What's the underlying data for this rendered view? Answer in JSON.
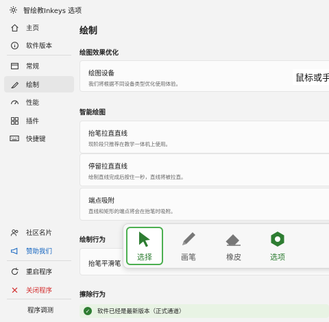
{
  "window": {
    "title": "智绘教Inkeys 选项",
    "icon": "gear-icon"
  },
  "sidebar": {
    "items": [
      {
        "label": "主页",
        "icon": "home-icon"
      },
      {
        "label": "软件版本",
        "icon": "info-icon"
      },
      {
        "label": "常规",
        "icon": "window-icon"
      },
      {
        "label": "绘制",
        "icon": "pen-icon",
        "active": true
      },
      {
        "label": "性能",
        "icon": "gauge-icon"
      },
      {
        "label": "插件",
        "icon": "puzzle-icon"
      },
      {
        "label": "快捷键",
        "icon": "keyboard-icon"
      }
    ],
    "bottom_items": [
      {
        "label": "社区名片",
        "icon": "people-icon"
      },
      {
        "label": "赞助我们",
        "icon": "megaphone-icon"
      },
      {
        "label": "重启程序",
        "icon": "restart-icon"
      },
      {
        "label": "关闭程序",
        "icon": "close-icon"
      },
      {
        "label": "程序调测",
        "icon": ""
      }
    ]
  },
  "main": {
    "title": "绘制",
    "sections": [
      {
        "title": "绘图效果优化",
        "cards": [
          {
            "title": "绘图设备",
            "desc": "我们将根据不同设备类型优化使用体验。",
            "value": "鼠标或手"
          }
        ]
      },
      {
        "title": "智能绘图",
        "cards": [
          {
            "title": "抬笔拉直直线",
            "desc": "现阶段只推荐在教学一体机上使用。"
          },
          {
            "title": "停留拉直直线",
            "desc": "绘制直线完成后按住一秒，直线将被拉直。"
          },
          {
            "title": "端点吸附",
            "desc": "直线和矩形的端点将会在抬笔时吸附。"
          }
        ]
      },
      {
        "title": "绘制行为",
        "cards": [
          {
            "title": "抬笔平滑笔",
            "desc": ""
          }
        ]
      },
      {
        "title": "擦除行为",
        "cards": []
      }
    ]
  },
  "toolbar": {
    "tools": [
      {
        "label": "选择",
        "icon": "cursor-arrow-icon",
        "selected": true
      },
      {
        "label": "画笔",
        "icon": "pencil-icon"
      },
      {
        "label": "橡皮",
        "icon": "eraser-icon"
      },
      {
        "label": "选项",
        "icon": "hexagon-gear-icon"
      }
    ]
  },
  "status": {
    "text": "软件已经是最新版本（正式通道）"
  },
  "colors": {
    "accent_green": "#2e7d32",
    "selected_border": "#4caf50",
    "link_blue": "#1565c0",
    "danger_red": "#d32f2f",
    "status_bg": "#e8f3e4"
  }
}
